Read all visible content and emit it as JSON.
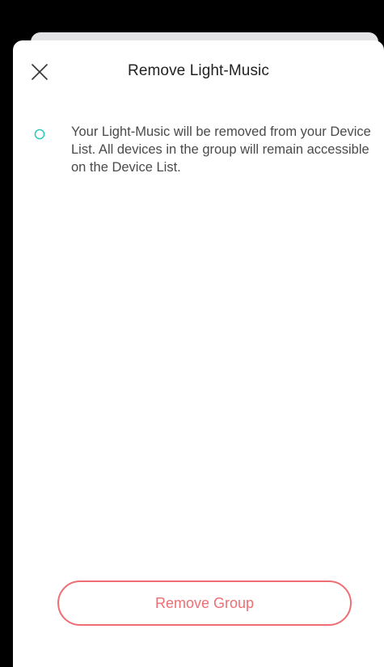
{
  "dialog": {
    "title": "Remove Light-Music",
    "close_icon": "close-icon"
  },
  "notice": {
    "bullet_icon": "circle-bullet-icon",
    "text": "Your Light-Music will be removed from your Device List. All devices in the group will remain accessible on the Device List."
  },
  "actions": {
    "remove_label": "Remove Group"
  },
  "colors": {
    "danger": "#ee6e74",
    "bullet": "#1fc7b6",
    "title_text": "#222222",
    "body_text": "#4a4a4a"
  }
}
